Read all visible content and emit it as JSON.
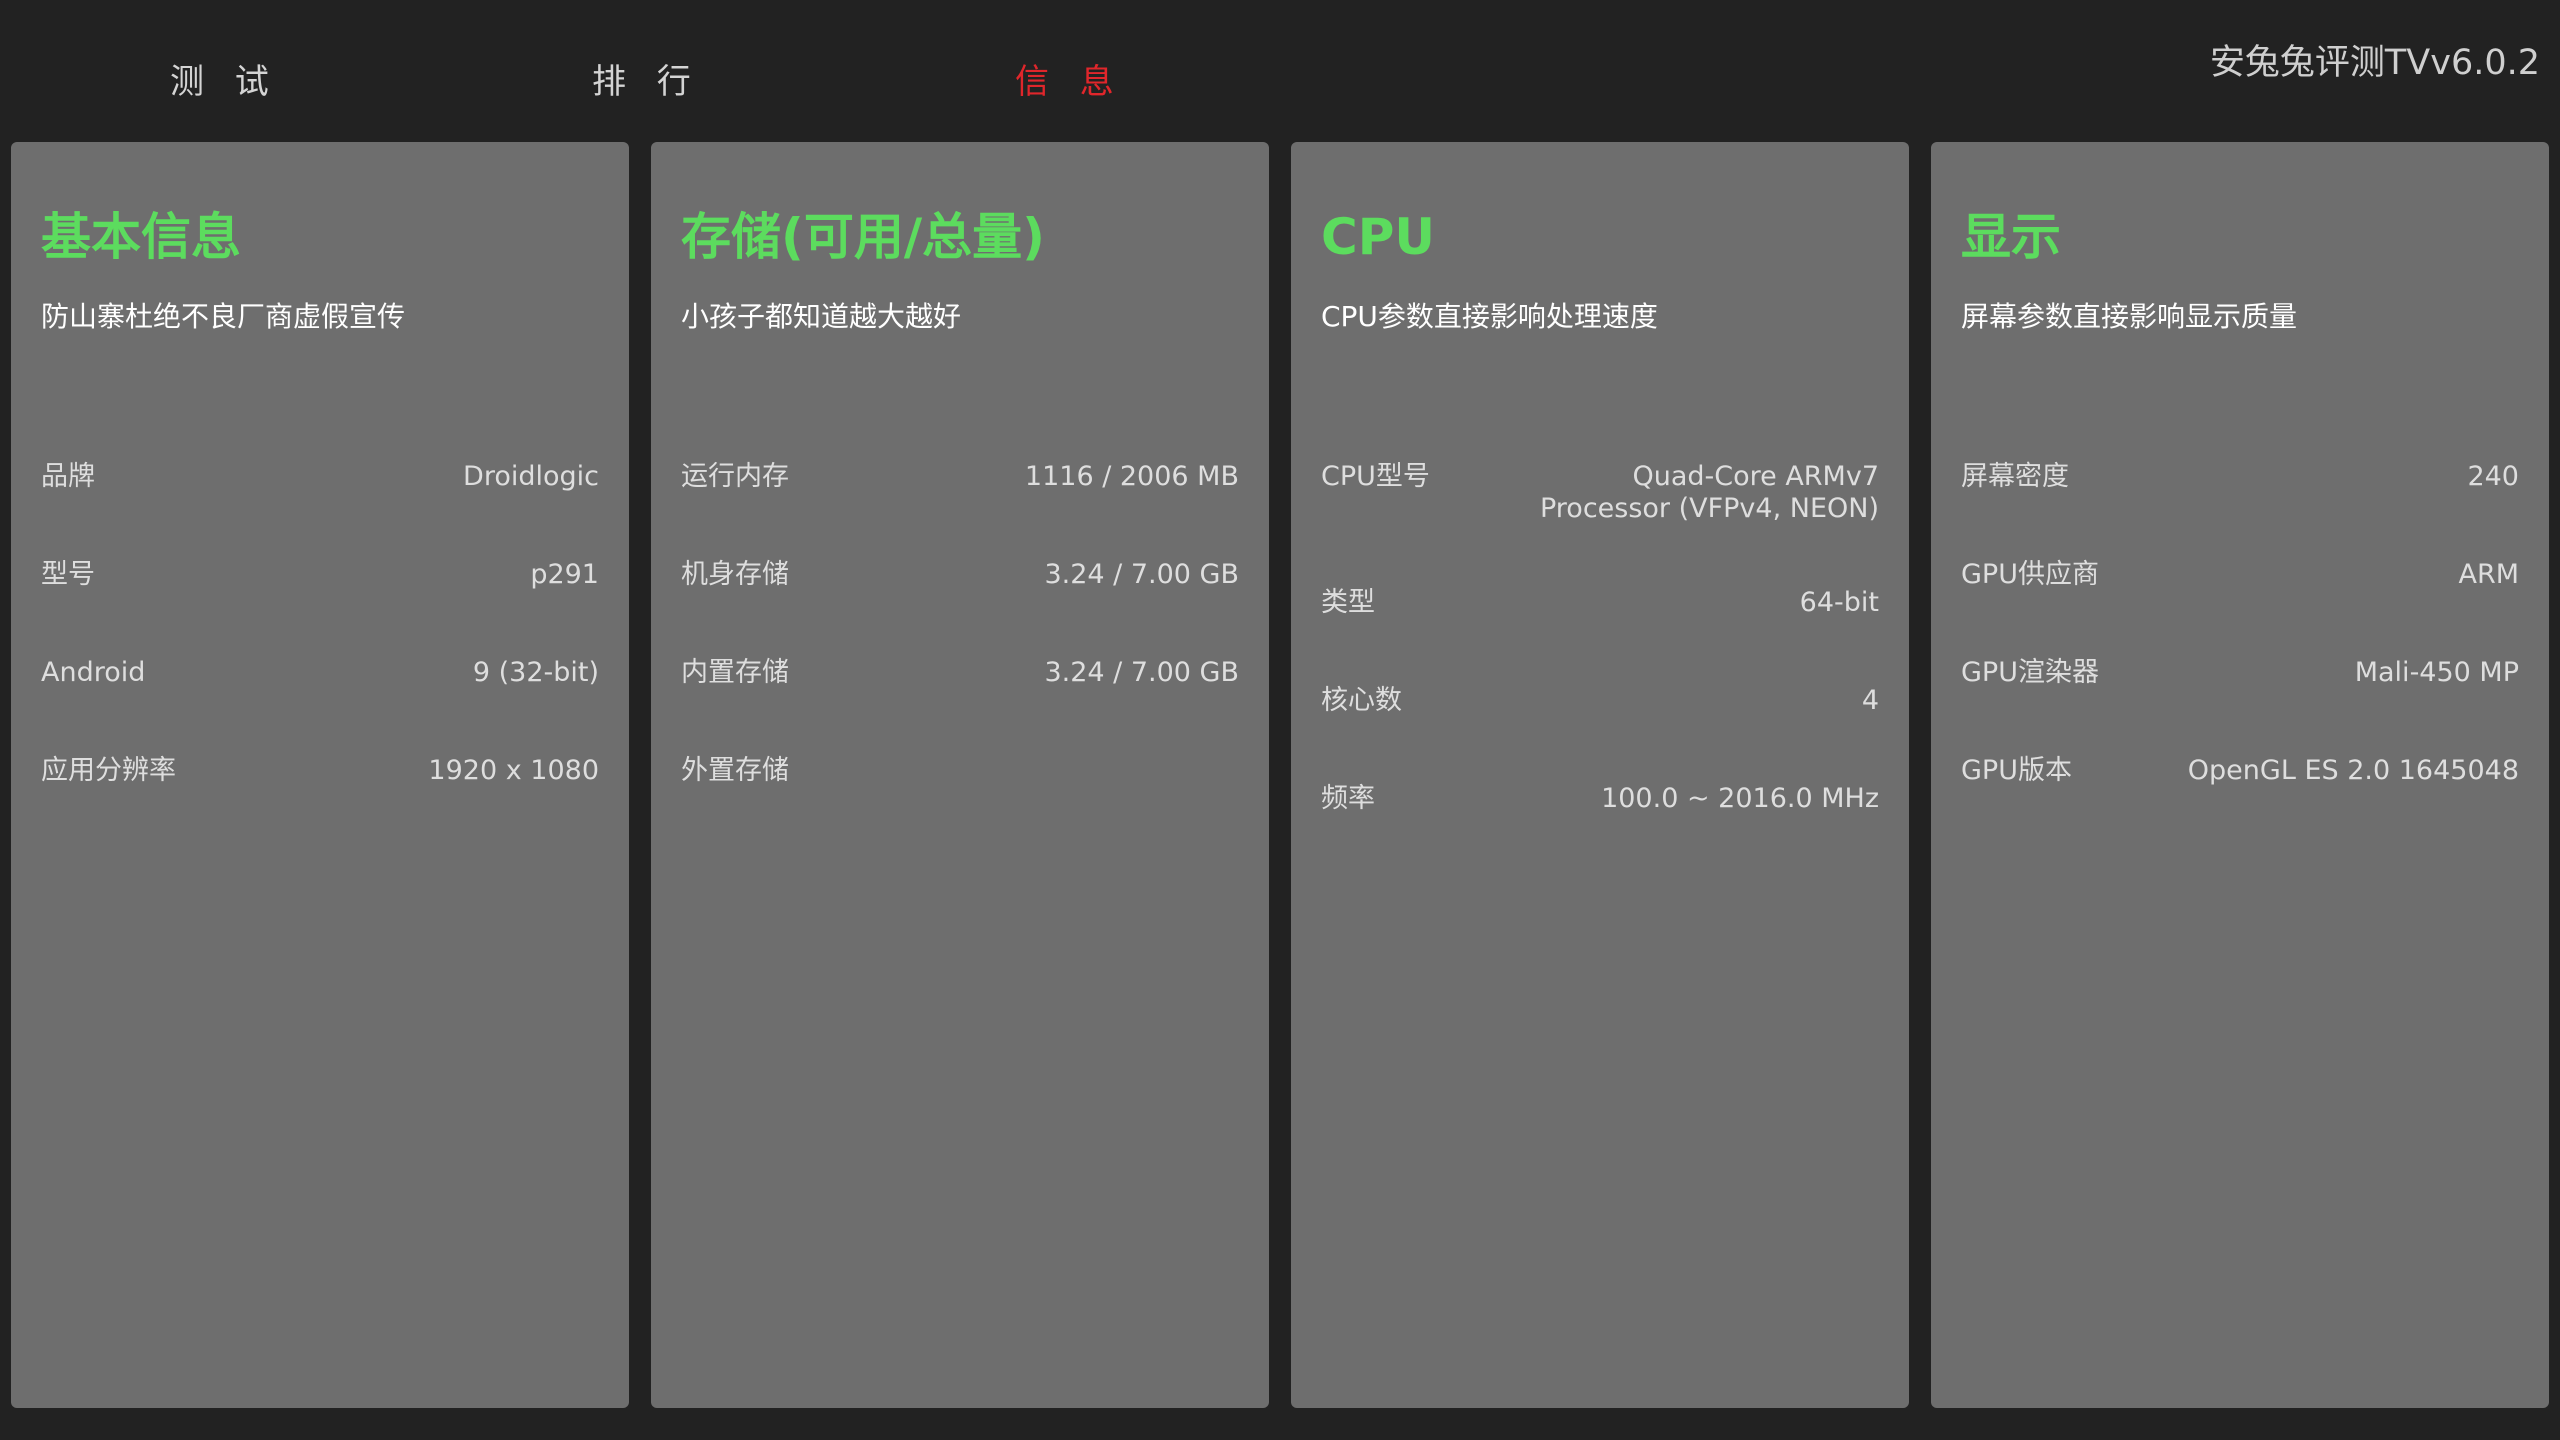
{
  "tabs": [
    {
      "label": "测 试",
      "active": false
    },
    {
      "label": "排 行",
      "active": false
    },
    {
      "label": "信 息",
      "active": true
    }
  ],
  "app_title": "安兔兔评测TVv6.0.2",
  "colors": {
    "background": "#222222",
    "card": "#6e6e6e",
    "title_accent": "#5cdc5e",
    "active_tab": "#e0262b"
  },
  "cards": [
    {
      "title": "基本信息",
      "subtitle": "防山寨杜绝不良厂商虚假宣传",
      "rows": [
        {
          "label": "品牌",
          "value": "Droidlogic"
        },
        {
          "label": "型号",
          "value": "p291"
        },
        {
          "label": "Android",
          "value": "9 (32-bit)"
        },
        {
          "label": "应用分辨率",
          "value": "1920 x 1080"
        }
      ]
    },
    {
      "title": "存储(可用/总量)",
      "subtitle": "小孩子都知道越大越好",
      "rows": [
        {
          "label": "运行内存",
          "value": "1116 / 2006 MB"
        },
        {
          "label": "机身存储",
          "value": "3.24 / 7.00 GB"
        },
        {
          "label": "内置存储",
          "value": "3.24 / 7.00 GB"
        },
        {
          "label": "外置存储",
          "value": ""
        }
      ]
    },
    {
      "title": "CPU",
      "subtitle": "CPU参数直接影响处理速度",
      "rows": [
        {
          "label": "CPU型号",
          "value": "Quad-Core ARMv7 Processor (VFPv4, NEON)"
        },
        {
          "label": "类型",
          "value": "64-bit"
        },
        {
          "label": "核心数",
          "value": "4"
        },
        {
          "label": "频率",
          "value": "100.0 ~ 2016.0 MHz"
        }
      ]
    },
    {
      "title": "显示",
      "subtitle": "屏幕参数直接影响显示质量",
      "rows": [
        {
          "label": "屏幕密度",
          "value": "240"
        },
        {
          "label": "GPU供应商",
          "value": "ARM"
        },
        {
          "label": "GPU渲染器",
          "value": "Mali-450 MP"
        },
        {
          "label": "GPU版本",
          "value": "OpenGL ES 2.0 1645048"
        }
      ]
    }
  ]
}
